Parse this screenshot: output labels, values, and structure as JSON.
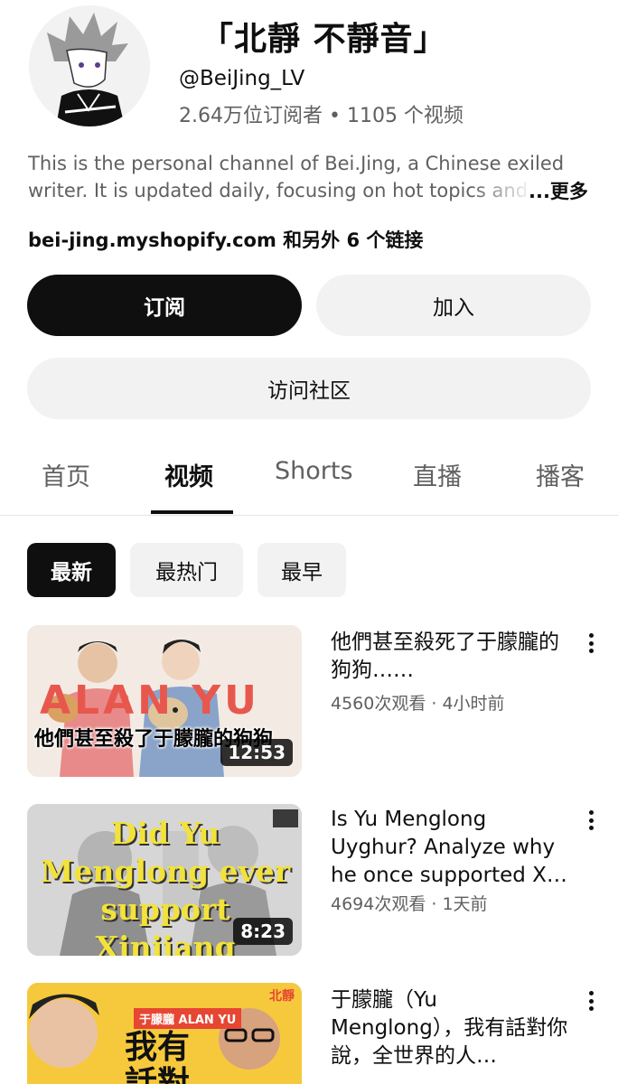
{
  "channel": {
    "title": "「北靜 不靜音」",
    "handle": "@BeiJing_LV",
    "stats": "2.64万位订阅者 • 1105 个视频",
    "description_line1": "This is the personal channel of Bei.Jing, a Chinese exiled",
    "description_line2": "writer. It is updated daily, focusing on hot topics and c",
    "more_label": "...更多",
    "link_domain": "bei-jing.myshopify.com",
    "link_more": " 和另外 6 个链接"
  },
  "buttons": {
    "subscribe": "订阅",
    "join": "加入",
    "community": "访问社区"
  },
  "tabs": [
    {
      "label": "首页"
    },
    {
      "label": "视频"
    },
    {
      "label": "Shorts"
    },
    {
      "label": "直播"
    },
    {
      "label": "播客"
    }
  ],
  "chips": [
    {
      "label": "最新"
    },
    {
      "label": "最热门"
    },
    {
      "label": "最早"
    }
  ],
  "videos": [
    {
      "title": "他們甚至殺死了于朦朧的狗狗……",
      "meta": "4560次观看 · 4小时前",
      "duration": "12:53",
      "thumb_text": "他們甚至殺了于朦朧的狗狗",
      "thumb_overlay": "ALAN YU"
    },
    {
      "title": "Is Yu Menglong Uyghur? Analyze why he once supported X…",
      "meta": "4694次观看 · 1天前",
      "duration": "8:23",
      "thumb_text": "Did Yu Menglong ever support Xinjiang cotton?"
    },
    {
      "title": "于朦朧（Yu Menglong），我有話對你說，全世界的人…",
      "meta": "",
      "thumb_text": "我有話對你說",
      "thumb_badge": "于朦朧 ALAN YU",
      "thumb_corner": "北靜"
    }
  ],
  "colors": {
    "primary_text": "#0f0f0f",
    "secondary_text": "#606060",
    "chip_bg": "#f2f2f2"
  }
}
